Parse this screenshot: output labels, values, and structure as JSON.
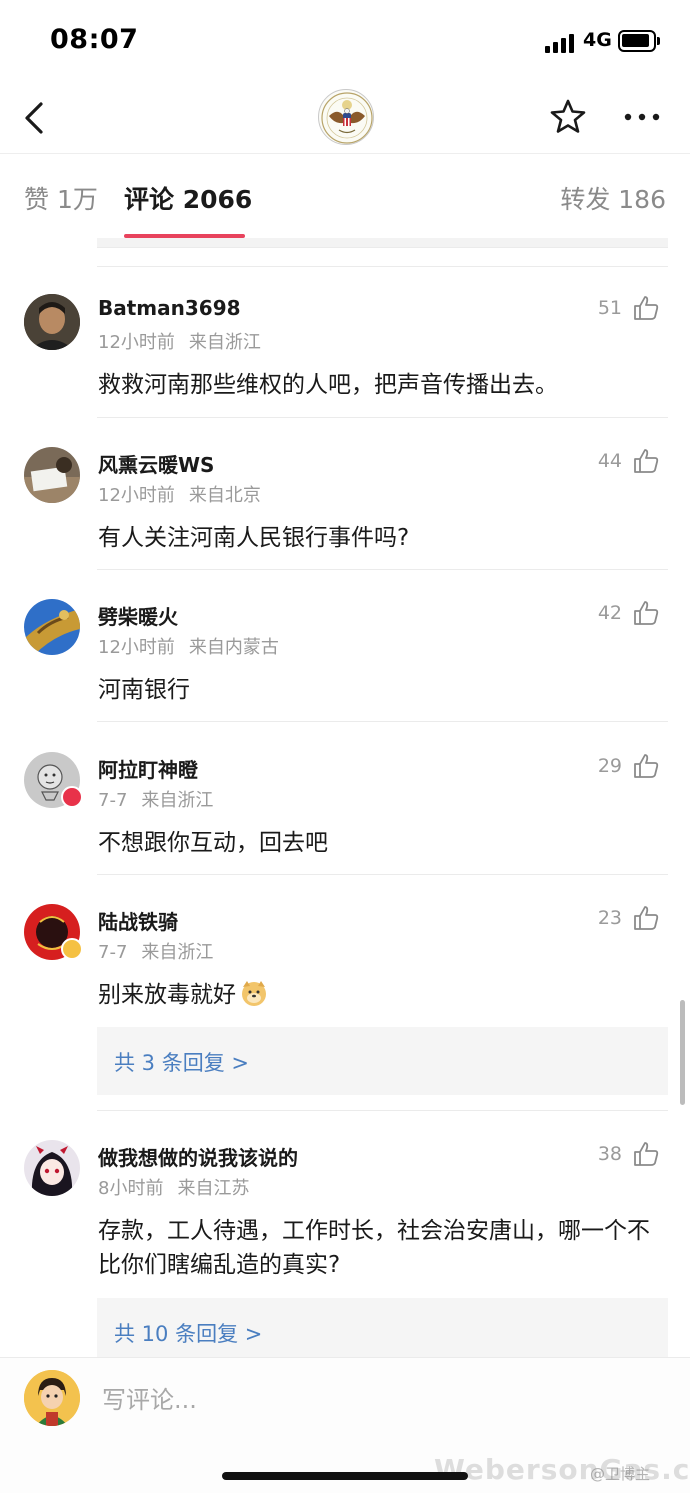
{
  "status_bar": {
    "time": "08:07",
    "network": "4G"
  },
  "nav": {
    "avatar": "us-seal-avatar"
  },
  "tabs": {
    "likes": "赞 1万",
    "comments": "评论 2066",
    "reposts": "转发 186"
  },
  "comments": [
    {
      "user": "Batman3698",
      "time": "12小时前",
      "location": "来自浙江",
      "likes": "51",
      "text": "救救河南那些维权的人吧，把声音传播出去。"
    },
    {
      "user": "风熏云暖WS",
      "time": "12小时前",
      "location": "来自北京",
      "likes": "44",
      "text": "有人关注河南人民银行事件吗?"
    },
    {
      "user": "劈柴暖火",
      "time": "12小时前",
      "location": "来自内蒙古",
      "likes": "42",
      "text": "河南银行"
    },
    {
      "user": "阿拉盯神瞪",
      "time": "7-7",
      "location": "来自浙江",
      "likes": "29",
      "text": "不想跟你互动，回去吧"
    },
    {
      "user": "陆战铁骑",
      "time": "7-7",
      "location": "来自浙江",
      "likes": "23",
      "text": "别来放毒就好",
      "replies": "共 3 条回复 >"
    },
    {
      "user": "做我想做的说我该说的",
      "time": "8小时前",
      "location": "来自江苏",
      "likes": "38",
      "text": "存款，工人待遇，工作时长，社会治安唐山，哪一个不比你们瞎编乱造的真实?",
      "replies": "共 10 条回复 >"
    }
  ],
  "input": {
    "placeholder": "写评论..."
  },
  "watermark": {
    "text": "WebersonGas.com",
    "weibo": "@卫博主"
  },
  "colors": {
    "accent": "#e8435d",
    "link": "#4a7ec0",
    "muted": "#9a9a9a"
  }
}
